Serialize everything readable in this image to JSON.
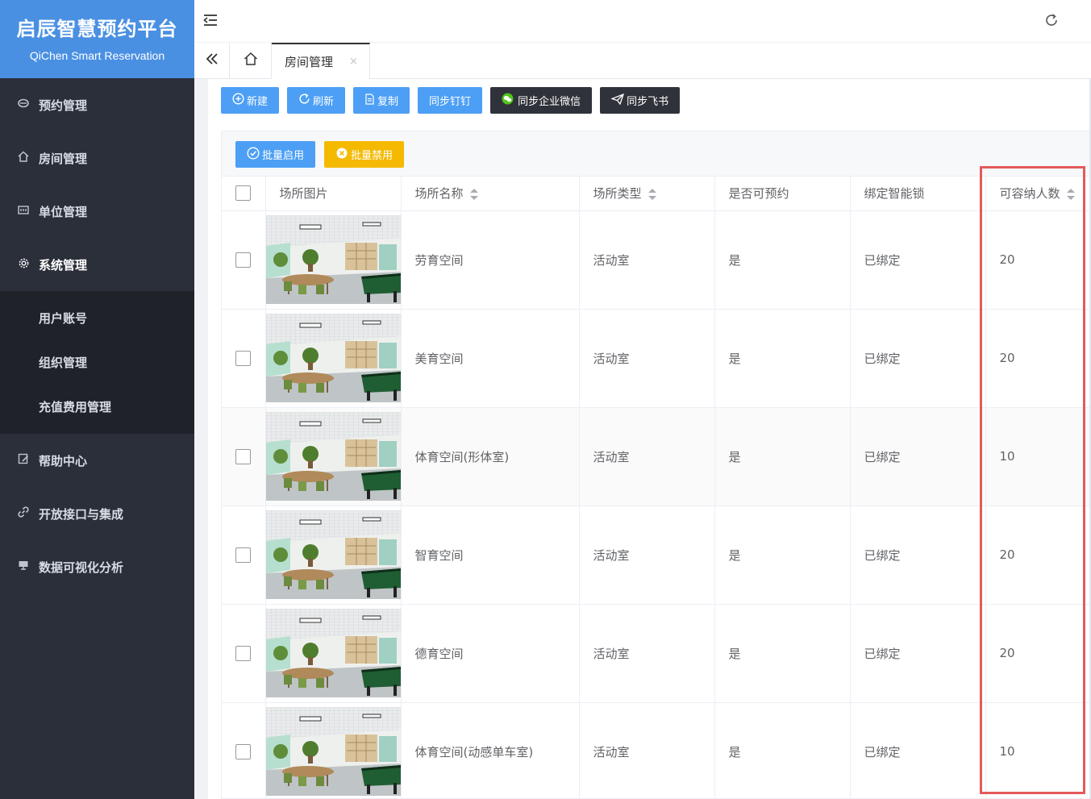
{
  "brand": {
    "title": "启辰智慧预约平台",
    "subtitle": "QiChen Smart Reservation"
  },
  "sidebar": {
    "items": [
      {
        "label": "预约管理",
        "icon": "reservation-icon"
      },
      {
        "label": "房间管理",
        "icon": "home-icon"
      },
      {
        "label": "单位管理",
        "icon": "building-icon"
      },
      {
        "label": "系统管理",
        "icon": "gear-icon"
      }
    ],
    "sub_items": [
      {
        "label": "用户账号"
      },
      {
        "label": "组织管理"
      },
      {
        "label": "充值费用管理"
      }
    ],
    "items_after": [
      {
        "label": "帮助中心",
        "icon": "help-icon"
      },
      {
        "label": "开放接口与集成",
        "icon": "link-icon"
      },
      {
        "label": "数据可视化分析",
        "icon": "monitor-icon"
      }
    ]
  },
  "tabs": {
    "active_label": "房间管理",
    "close_glyph": "×"
  },
  "toolbar": {
    "new_label": "新建",
    "refresh_label": "刷新",
    "copy_label": "复制",
    "dingtalk_label": "同步钉钉",
    "wecom_label": "同步企业微信",
    "feishu_label": "同步飞书"
  },
  "batch": {
    "enable_label": "批量启用",
    "disable_label": "批量禁用"
  },
  "table": {
    "headers": {
      "image": "场所图片",
      "name": "场所名称",
      "type": "场所类型",
      "bookable": "是否可预约",
      "lock": "绑定智能锁",
      "capacity": "可容纳人数"
    },
    "rows": [
      {
        "name": "劳育空间",
        "type": "活动室",
        "bookable": "是",
        "lock": "已绑定",
        "capacity": "20"
      },
      {
        "name": "美育空间",
        "type": "活动室",
        "bookable": "是",
        "lock": "已绑定",
        "capacity": "20"
      },
      {
        "name": "体育空间(形体室)",
        "type": "活动室",
        "bookable": "是",
        "lock": "已绑定",
        "capacity": "10"
      },
      {
        "name": "智育空间",
        "type": "活动室",
        "bookable": "是",
        "lock": "已绑定",
        "capacity": "20"
      },
      {
        "name": "德育空间",
        "type": "活动室",
        "bookable": "是",
        "lock": "已绑定",
        "capacity": "20"
      },
      {
        "name": "体育空间(动感单车室)",
        "type": "活动室",
        "bookable": "是",
        "lock": "已绑定",
        "capacity": "10"
      }
    ]
  },
  "colors": {
    "sidebar_bg": "#2b2f3a",
    "brand_bg": "#4a90e2",
    "primary": "#4c9ff5",
    "dark_button": "#2f323a",
    "warning": "#f5b900",
    "highlight": "#e45a5a"
  }
}
